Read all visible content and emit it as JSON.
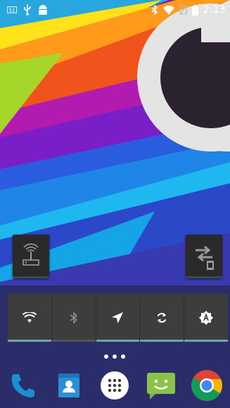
{
  "status_bar": {
    "time": "2:13",
    "left_icons": [
      "notification-number-icon",
      "usb-icon",
      "android-debug-icon"
    ],
    "right_icons": [
      "bluetooth-icon",
      "wifi-icon",
      "no-sim-icon",
      "battery-icon"
    ]
  },
  "home": {
    "widgets": [
      {
        "name": "wifi-hotspot-widget",
        "icon": "hotspot-icon"
      },
      {
        "name": "data-sync-widget",
        "icon": "transfer-icon"
      }
    ],
    "quick_settings": [
      {
        "name": "wifi",
        "icon": "wifi-icon",
        "state": "on"
      },
      {
        "name": "bluetooth",
        "icon": "bluetooth-icon",
        "state": "off"
      },
      {
        "name": "location",
        "icon": "location-icon",
        "state": "on"
      },
      {
        "name": "sync",
        "icon": "sync-icon",
        "state": "on"
      },
      {
        "name": "auto-brightness",
        "icon": "brightness-auto-icon",
        "state": "on"
      }
    ],
    "page_indicator": {
      "pages": 3
    }
  },
  "dock": {
    "apps": [
      {
        "name": "phone",
        "icon": "phone-icon",
        "color": "#1b8fd3"
      },
      {
        "name": "contacts",
        "icon": "contacts-icon",
        "color": "#2a8fd6"
      },
      {
        "name": "app-drawer",
        "icon": "app-drawer-icon",
        "color": "#ffffff"
      },
      {
        "name": "messaging",
        "icon": "messaging-icon",
        "color": "#8bc34a"
      },
      {
        "name": "chrome",
        "icon": "chrome-icon",
        "color": "#db4437"
      }
    ]
  }
}
